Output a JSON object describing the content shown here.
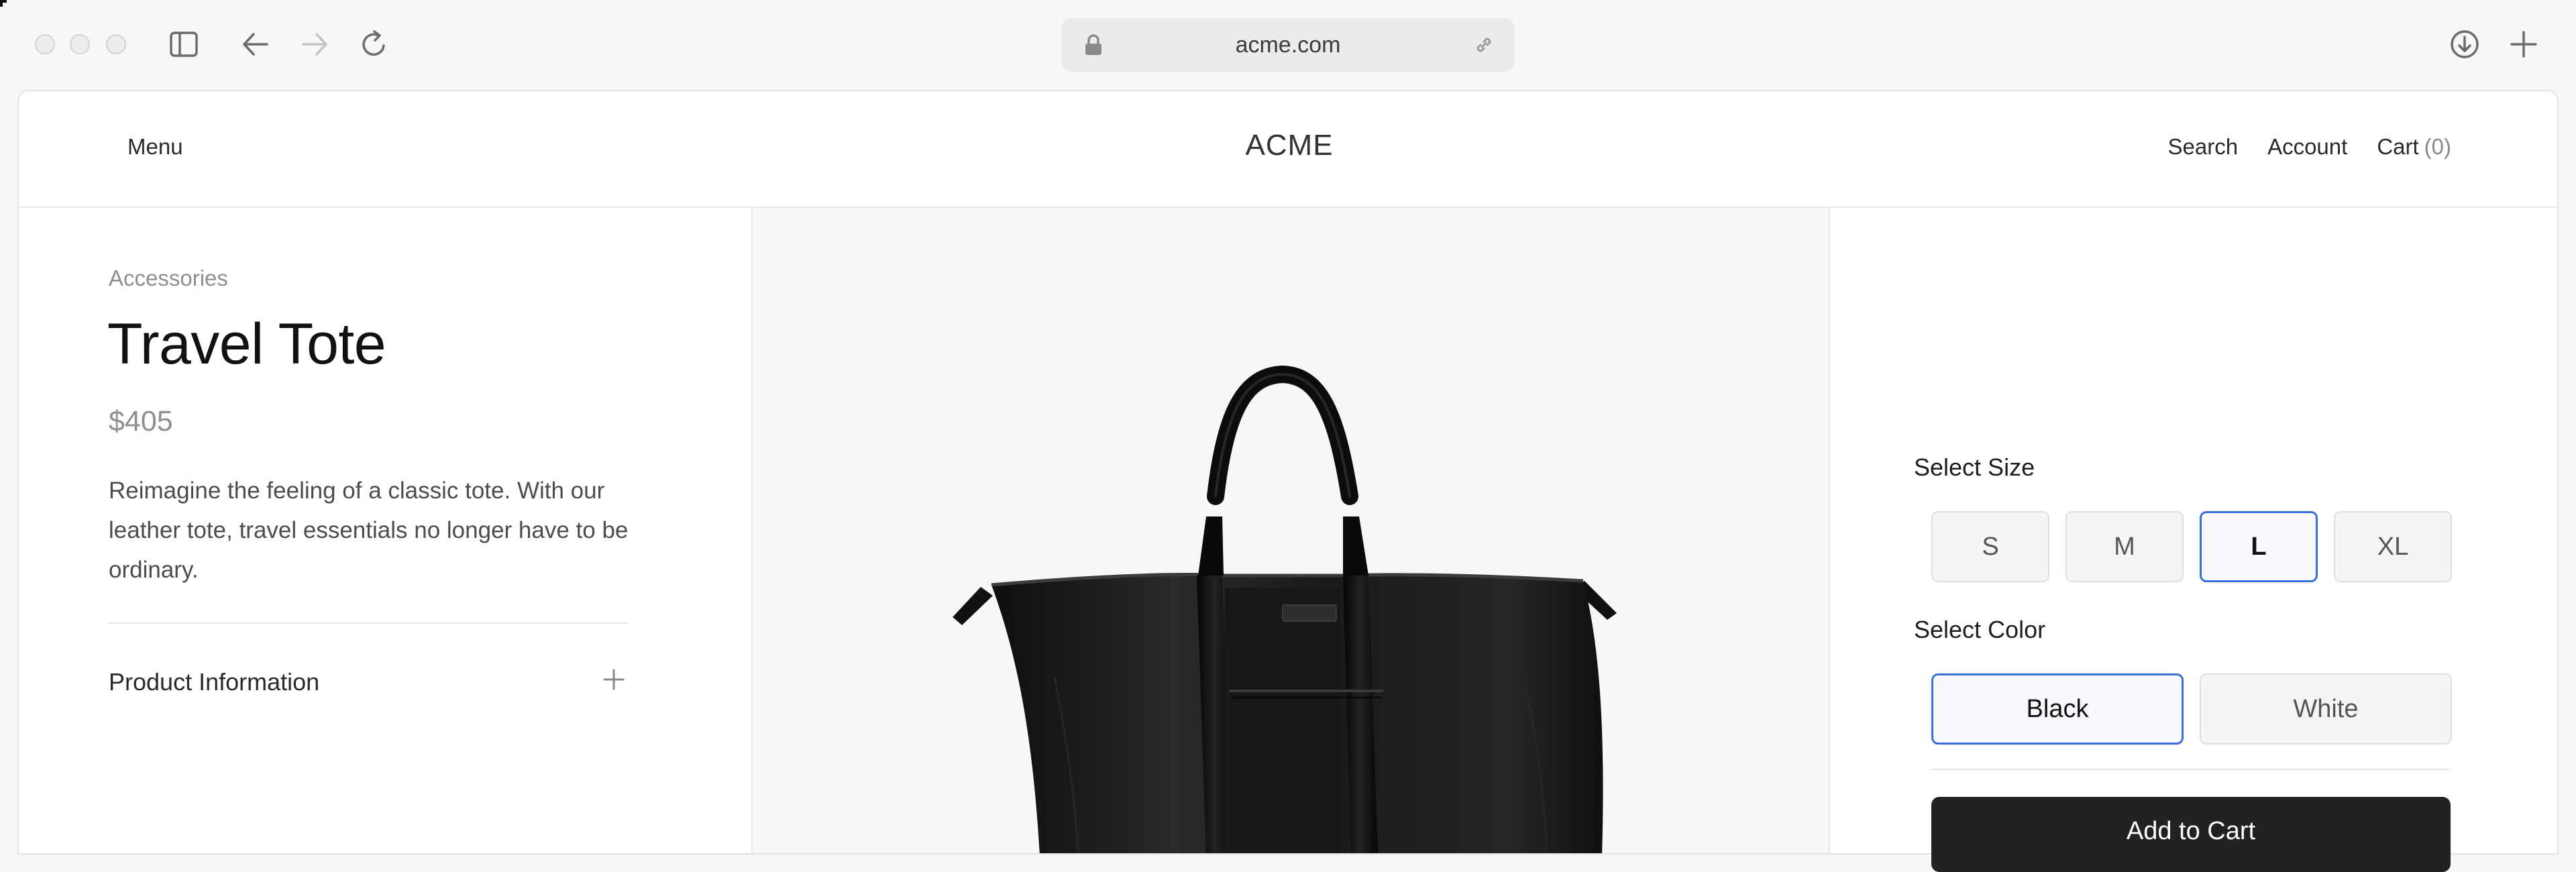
{
  "browser": {
    "url": "acme.com",
    "icons": [
      "sidebar-icon",
      "back-arrow-icon",
      "forward-arrow-icon",
      "reload-icon",
      "lock-icon",
      "link-icon",
      "download-icon",
      "plus-icon"
    ]
  },
  "nav": {
    "menu_label": "Menu",
    "logo": "ACME",
    "search_label": "Search",
    "account_label": "Account",
    "cart_label": "Cart",
    "cart_count": "(0)"
  },
  "product": {
    "category": "Accessories",
    "title": "Travel Tote",
    "price": "$405",
    "description": "Reimagine the feeling of a classic tote. With our leather tote, travel essentials no longer have to be ordinary.",
    "accordion_label": "Product Information"
  },
  "options": {
    "size_label": "Select Size",
    "sizes": [
      "S",
      "M",
      "L",
      "XL"
    ],
    "selected_size": "L",
    "color_label": "Select Color",
    "colors": [
      "Black",
      "White"
    ],
    "selected_color": "Black",
    "add_to_cart": "Add to Cart"
  },
  "colors": {
    "accent": "#3a6fd8",
    "button_dark": "#222222",
    "muted_text": "#8f8f8f",
    "image_bg": "#f7f7f7"
  }
}
